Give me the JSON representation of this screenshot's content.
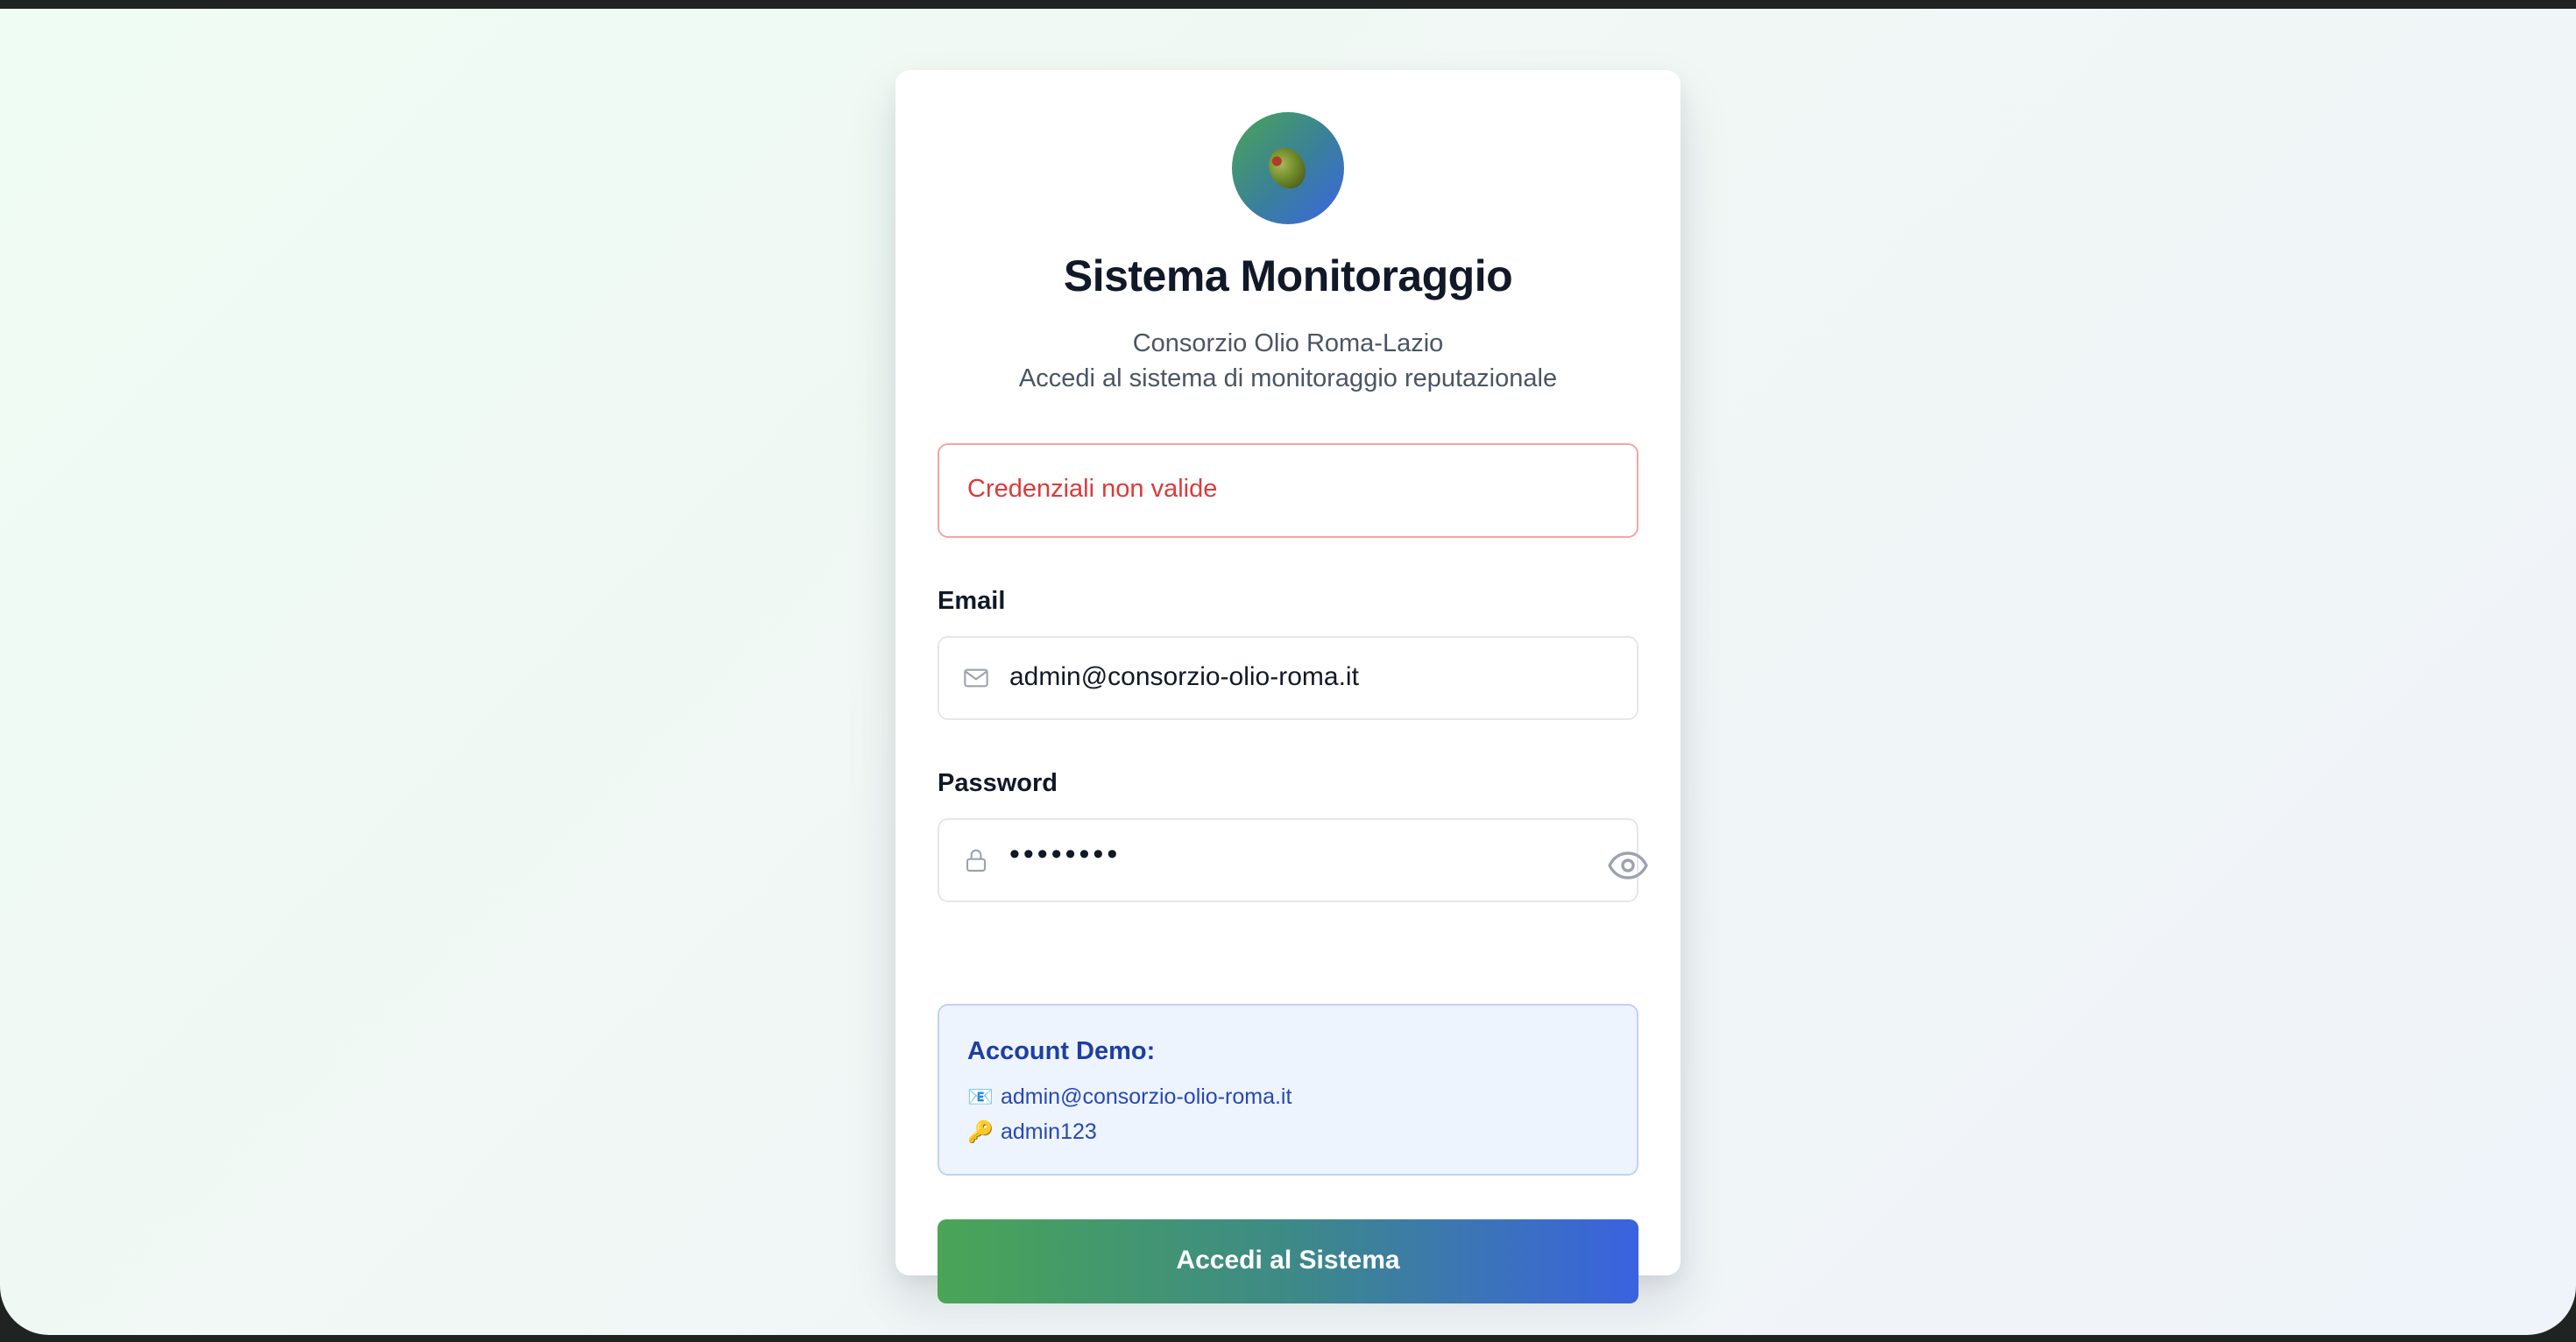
{
  "header": {
    "title": "Sistema Monitoraggio",
    "subtitle_org": "Consorzio Olio Roma-Lazio",
    "subtitle_desc": "Accedi al sistema di monitoraggio reputazionale"
  },
  "logo": {
    "icon": "olive-icon"
  },
  "error": {
    "message": "Credenziali non valide"
  },
  "form": {
    "email_label": "Email",
    "email_value": "admin@consorzio-olio-roma.it",
    "email_icon": "mail-icon",
    "password_label": "Password",
    "password_value": "••••••••",
    "password_icon": "lock-icon",
    "toggle_icon": "eye-icon"
  },
  "demo": {
    "title": "Account Demo:",
    "email_emoji": "📧",
    "email": "admin@consorzio-olio-roma.it",
    "password_emoji": "🔑",
    "password": "admin123"
  },
  "submit": {
    "label": "Accedi al Sistema"
  },
  "colors": {
    "primary_gradient_start": "#4aa556",
    "primary_gradient_end": "#3a62e0",
    "error": "#dc3a3a",
    "demo_text": "#2748b8"
  }
}
